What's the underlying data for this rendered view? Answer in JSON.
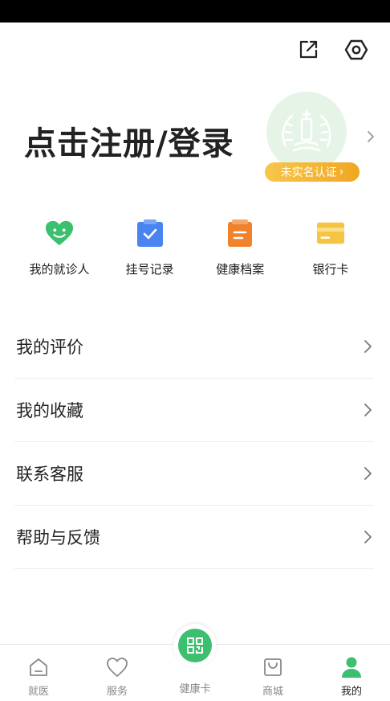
{
  "header": {
    "actions": [
      {
        "icon": "share-icon"
      },
      {
        "icon": "settings-icon"
      }
    ]
  },
  "profile": {
    "login_prompt": "点击注册/登录",
    "verify_badge": "未实名认证",
    "verify_chevron": "›"
  },
  "shortcuts": [
    {
      "label": "我的就诊人",
      "icon": "heart-smile-icon",
      "color": "#3cbf6e"
    },
    {
      "label": "挂号记录",
      "icon": "clipboard-check-icon",
      "color": "#4a84f0"
    },
    {
      "label": "健康档案",
      "icon": "document-icon",
      "color": "#f0822d"
    },
    {
      "label": "银行卡",
      "icon": "bank-card-icon",
      "color": "#f6c445"
    }
  ],
  "menu": [
    {
      "label": "我的评价"
    },
    {
      "label": "我的收藏"
    },
    {
      "label": "联系客服"
    },
    {
      "label": "帮助与反馈"
    }
  ],
  "tabbar": {
    "tabs": [
      {
        "label": "就医",
        "icon": "home-icon"
      },
      {
        "label": "服务",
        "icon": "heart-outline-icon"
      },
      {
        "label": "健康卡",
        "icon": "qr-code-icon"
      },
      {
        "label": "商城",
        "icon": "shopping-bag-icon"
      },
      {
        "label": "我的",
        "icon": "person-icon",
        "active": true
      }
    ]
  },
  "colors": {
    "accent": "#3cbf6e",
    "badge": "#f0a721",
    "text": "#222222",
    "muted": "#888888"
  }
}
